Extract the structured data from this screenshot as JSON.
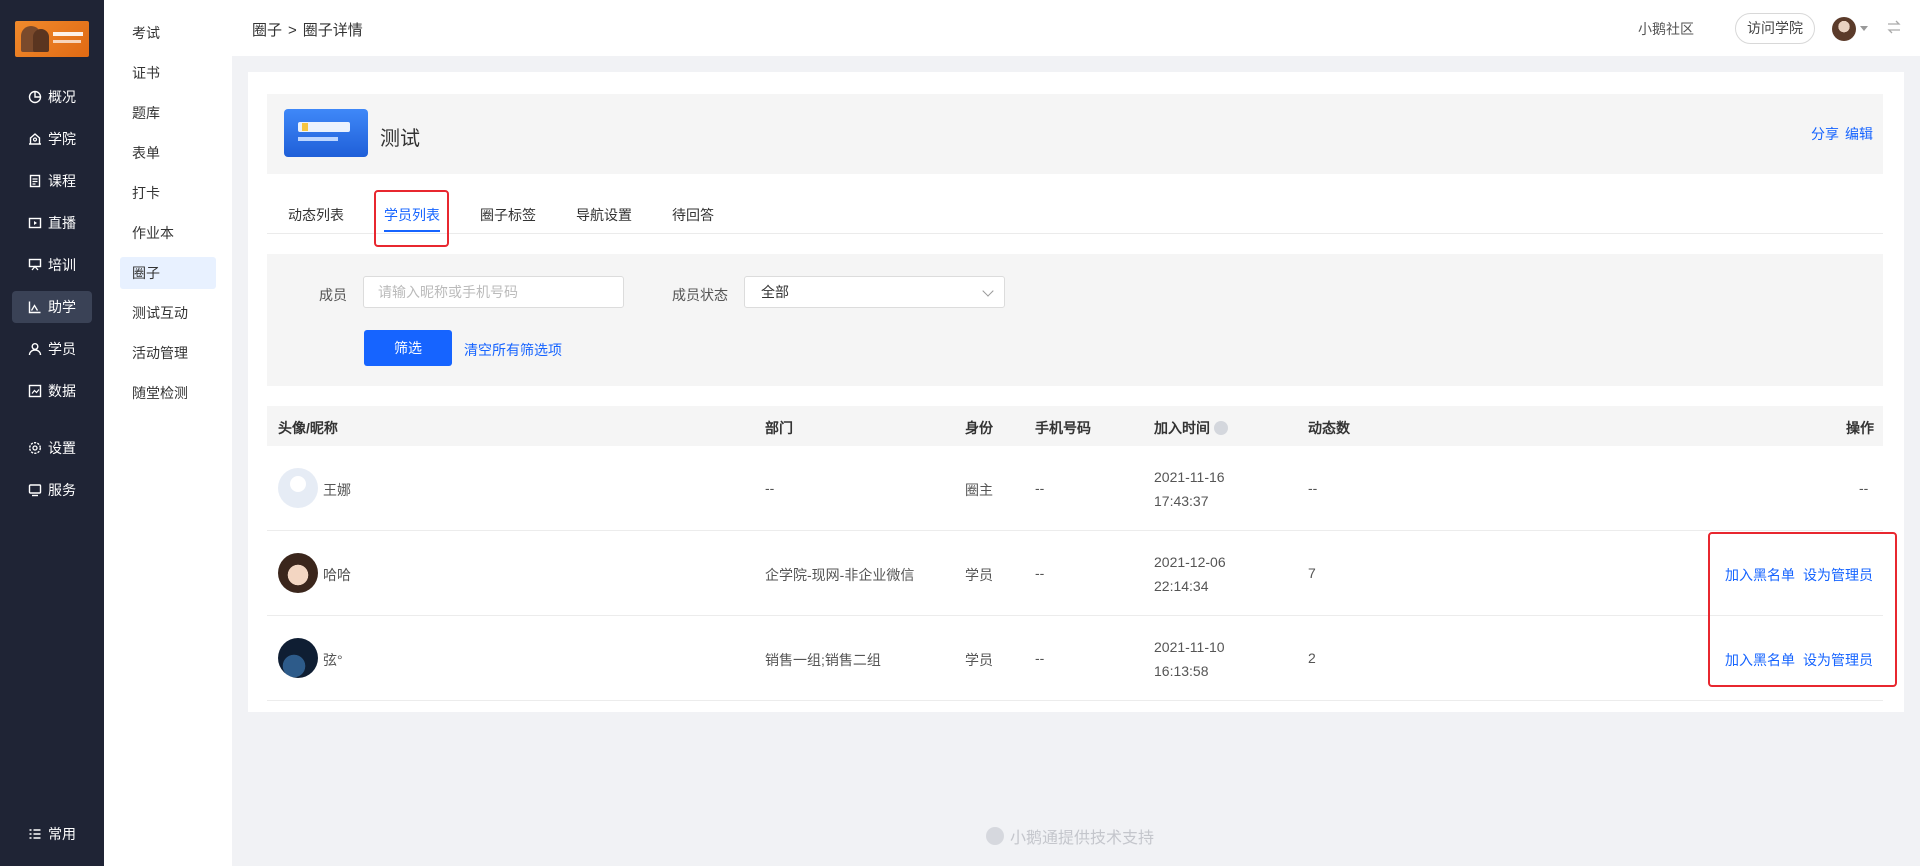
{
  "nav": {
    "items": [
      {
        "label": "概况",
        "icon": "pie-chart-icon"
      },
      {
        "label": "学院",
        "icon": "school-icon"
      },
      {
        "label": "课程",
        "icon": "course-icon"
      },
      {
        "label": "直播",
        "icon": "live-icon"
      },
      {
        "label": "培训",
        "icon": "training-icon"
      },
      {
        "label": "助学",
        "icon": "study-aid-icon"
      },
      {
        "label": "学员",
        "icon": "user-icon"
      },
      {
        "label": "数据",
        "icon": "data-icon"
      },
      {
        "label": "设置",
        "icon": "gear-icon"
      },
      {
        "label": "服务",
        "icon": "service-icon"
      },
      {
        "label": "常用",
        "icon": "list-icon"
      }
    ],
    "active": "助学"
  },
  "subnav": {
    "items": [
      "考试",
      "证书",
      "题库",
      "表单",
      "打卡",
      "作业本",
      "圈子",
      "测试互动",
      "活动管理",
      "随堂检测"
    ],
    "active": "圈子"
  },
  "header": {
    "breadcrumb_1": "圈子",
    "breadcrumb_sep": ">",
    "breadcrumb_2": "圈子详情",
    "community_link": "小鹅社区",
    "visit_button": "访问学院"
  },
  "circle": {
    "title": "测试",
    "share_label": "分享",
    "edit_label": "编辑"
  },
  "tabs": [
    "动态列表",
    "学员列表",
    "圈子标签",
    "导航设置",
    "待回答"
  ],
  "active_tab": "学员列表",
  "filter": {
    "member_label": "成员",
    "member_placeholder": "请输入昵称或手机号码",
    "status_label": "成员状态",
    "status_value": "全部",
    "filter_button": "筛选",
    "clear_link": "清空所有筛选项"
  },
  "table": {
    "columns": [
      "头像/昵称",
      "部门",
      "身份",
      "手机号码",
      "加入时间",
      "动态数",
      "操作"
    ],
    "rows": [
      {
        "name": "王娜",
        "dept": "--",
        "role": "圈主",
        "phone": "--",
        "date": "2021-11-16",
        "time": "17:43:37",
        "posts": "--",
        "ops": "--"
      },
      {
        "name": "哈哈",
        "dept": "企学院-现网-非企业微信",
        "role": "学员",
        "phone": "--",
        "date": "2021-12-06",
        "time": "22:14:34",
        "posts": "7",
        "blacklist": "加入黑名单",
        "set_admin": "设为管理员"
      },
      {
        "name": "弦°",
        "dept": "销售一组;销售二组",
        "role": "学员",
        "phone": "--",
        "date": "2021-11-10",
        "time": "16:13:58",
        "posts": "2",
        "blacklist": "加入黑名单",
        "set_admin": "设为管理员"
      }
    ]
  },
  "footer": "小鹅通提供技术支持",
  "colors": {
    "primary": "#1664ff",
    "nav_bg": "#1f2435",
    "highlight": "#e8272f"
  }
}
